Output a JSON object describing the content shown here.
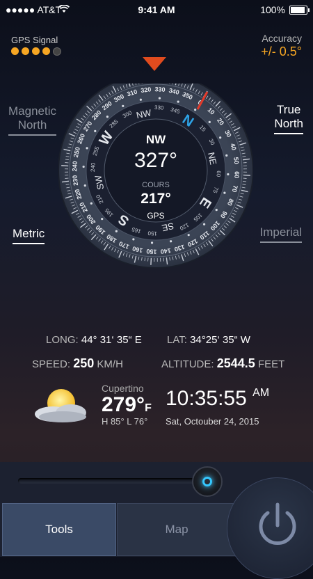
{
  "status_bar": {
    "carrier": "●●●●● AT&T",
    "time": "9:41 AM",
    "battery": "100%"
  },
  "gps": {
    "label": "GPS Signal",
    "bars_total": 5,
    "bars_active": 4
  },
  "accuracy": {
    "label": "Accuracy",
    "value": "+/- 0.5°"
  },
  "toggles": {
    "magnetic_line1": "Magnetic",
    "magnetic_line2": "North",
    "true_line1": "True",
    "true_line2": "North",
    "metric": "Metric",
    "imperial": "Imperial"
  },
  "compass": {
    "heading_dir": "NW",
    "heading_deg": "327°",
    "course_label": "COURS",
    "course_deg": "217°",
    "course_source": "GPS",
    "needle_deg": 327,
    "pointer_color": "#e04b1e",
    "cardinals": [
      "N",
      "NE",
      "E",
      "SE",
      "S",
      "SW",
      "W",
      "NW"
    ],
    "outer_labels": [
      "0",
      "10",
      "20",
      "30",
      "40",
      "50",
      "60",
      "70",
      "80",
      "90",
      "100",
      "110",
      "120",
      "130",
      "140",
      "150",
      "160",
      "170",
      "180",
      "190",
      "200",
      "210",
      "220",
      "230",
      "240",
      "250",
      "260",
      "270",
      "280",
      "290",
      "300",
      "310",
      "320",
      "330",
      "340",
      "350"
    ],
    "inner_labels": [
      "15",
      "30",
      "60",
      "75",
      "105",
      "120",
      "150",
      "165",
      "195",
      "210",
      "240",
      "255",
      "285",
      "300",
      "330",
      "345"
    ]
  },
  "location": {
    "long_label": "LONG:",
    "long_value": "44° 31‘ 35“ E",
    "lat_label": "LAT:",
    "lat_value": "34°25‘ 35“ W"
  },
  "speed": {
    "label": "SPEED:",
    "value": "250",
    "unit": "KM/H"
  },
  "altitude": {
    "label": "ALTITUDE:",
    "value": "2544.5",
    "unit": "FEET"
  },
  "weather": {
    "city": "Cupertino",
    "temp": "279°",
    "temp_unit": "F",
    "high_low": "H 85°  L 76°"
  },
  "clock": {
    "time": "10:35:55",
    "ampm": "AM",
    "date": "Sat, Octouber 24, 2015"
  },
  "tabs": {
    "tools": "Tools",
    "map": "Map"
  },
  "slider": {
    "position": 1.0
  }
}
